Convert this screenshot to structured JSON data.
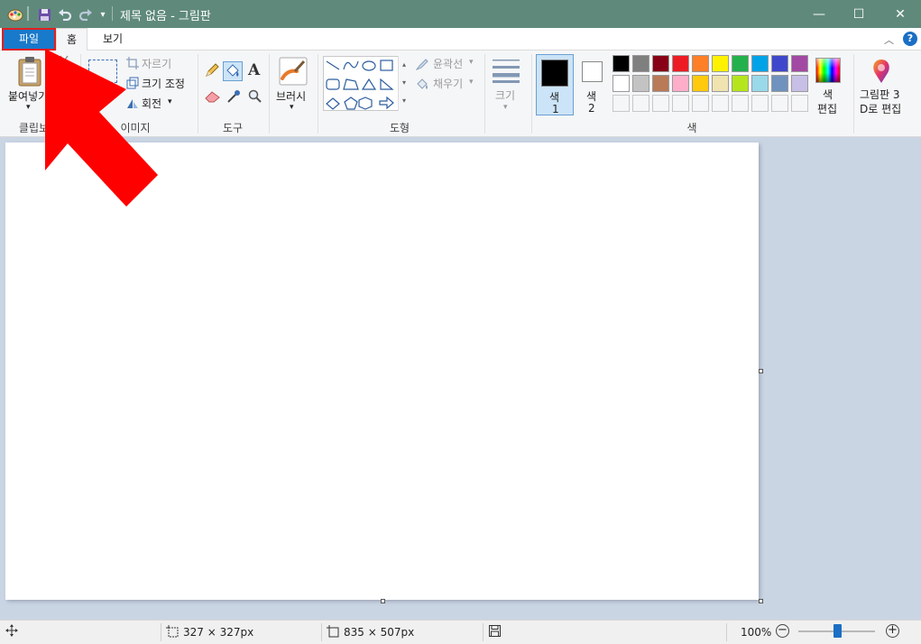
{
  "window": {
    "title": "제목 없음 - 그림판",
    "minimize_glyph": "—",
    "maximize_glyph": "☐",
    "close_glyph": "✕"
  },
  "tabs": {
    "file": "파일",
    "home": "홈",
    "view": "보기",
    "help_glyph": "?",
    "collapse_glyph": "︿"
  },
  "ribbon": {
    "clipboard": {
      "label": "클립보드",
      "paste": "붙여넣기"
    },
    "image": {
      "label": "이미지",
      "crop": "자르기",
      "resize": "크기 조정",
      "rotate": "회전"
    },
    "tools": {
      "label": "도구"
    },
    "brush": {
      "label": "브러시"
    },
    "shapes": {
      "label": "도형",
      "outline": "윤곽선",
      "fill": "채우기"
    },
    "size": {
      "label": "크기"
    },
    "colors": {
      "label": "색",
      "color1": "색",
      "color1_num": "1",
      "color2": "색",
      "color2_num": "2",
      "edit_colors_1": "색",
      "edit_colors_2": "편집",
      "paint3d_1": "그림판 3",
      "paint3d_2": "D로 편집",
      "primary_color": "#000000",
      "secondary_color": "#ffffff",
      "palette_row1": [
        "#000000",
        "#7f7f7f",
        "#880015",
        "#ed1c24",
        "#ff7f27",
        "#fff200",
        "#22b14c",
        "#00a2e8",
        "#3f48cc",
        "#a349a4"
      ],
      "palette_row2": [
        "#ffffff",
        "#c3c3c3",
        "#b97a57",
        "#ffaec9",
        "#ffc90e",
        "#efe4b0",
        "#b5e61d",
        "#99d9ea",
        "#7092be",
        "#c8bfe7"
      ]
    }
  },
  "status": {
    "selection_size": "327 × 327px",
    "canvas_size": "835 × 507px",
    "zoom": "100%",
    "zoom_level": 0.5
  },
  "icons": {
    "paint": "paint-app-icon",
    "save": "save-icon",
    "undo": "undo-icon",
    "redo": "redo-icon"
  }
}
